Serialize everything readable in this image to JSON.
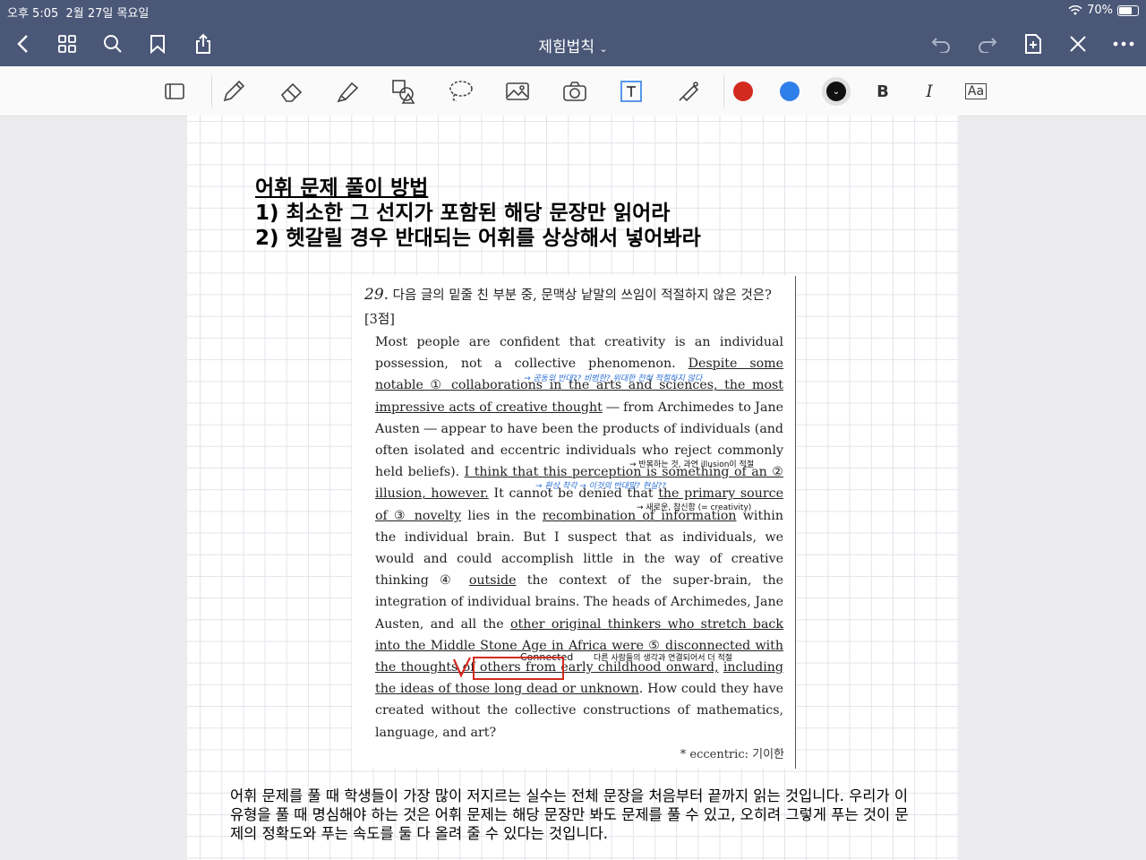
{
  "status": {
    "time": "오후 5:05",
    "date": "2월 27일 목요일",
    "battery": "70%"
  },
  "nav": {
    "title": "제힘법칙"
  },
  "toolbar": {
    "colors": [
      "#d32a20",
      "#2f7fe8",
      "#111111"
    ],
    "bold_label": "B",
    "italic_label": "I",
    "fontsize_label": "Aa"
  },
  "note": {
    "heading1": "어휘 문제 풀이 방법",
    "heading2": "1) 최소한 그 선지가 포함된 해당 문장만 읽어라",
    "heading3": "2) 헷갈릴 경우 반대되는 어휘를 상상해서 넣어봐라",
    "question_num": "29.",
    "question_text": "다음 글의 밑줄 친 부분 중, 문맥상 낱말의 쓰임이 적절하지 않은 것은? [3점]",
    "passage": [
      "Most people are confident that creativity is an individual possession, not a collective phenomenon. ",
      "Despite some notable ① collaborations in the arts and sciences, the most impressive acts of creative thought",
      " ― from Archimedes to Jane Austen ― appear to have been the products of individuals (and often isolated and eccentric individuals who reject commonly held beliefs). ",
      "I think that this perception is something of an ② illusion, however.",
      " It cannot be denied that ",
      "the primary source of ③ novelty",
      " lies in the ",
      "recombination of information",
      " within the individual brain. But I suspect that as individuals, we would and could accomplish little in the way of creative thinking ④ ",
      "outside",
      " the context of the super-brain, the integration of individual brains. The heads of Archimedes, Jane Austen, and all the ",
      "other original thinkers who stretch back into the Middle Stone Age in Africa were ⑤ disconnected with the thoughts of others from early childhood onward,",
      " ",
      "including the ideas of those long dead or unknown",
      ". How could they have created without the collective constructions of mathematics, language, and art?"
    ],
    "footnote": "* eccentric: 기이한",
    "annotations": {
      "a1": "→ 공동의 반대?? 비범한? 위대한 전혀 적절하지 않다",
      "a2": "→ 반복하는 것, 과연 illusion이 적절",
      "a3": "→ 환상 착각 → 이것의 반대말? 현실??",
      "a4": "→ 새로운, 참신함 (= creativity)",
      "a5": "Connected",
      "a6": "다른 사람들의 생각과 연결되어서 더 적절"
    },
    "footer": "어휘 문제를 풀 때 학생들이 가장 많이 저지르는 실수는 전체 문장을 처음부터 끝까지 읽는 것입니다. 우리가 이 유형을 풀 때 명심해야 하는 것은 어휘 문제는 해당 문장만 봐도 문제를 풀 수 있고, 오히려 그렇게 푸는 것이 문제의 정확도와 푸는 속도를 둘 다 올려 줄 수 있다는 것입니다."
  }
}
